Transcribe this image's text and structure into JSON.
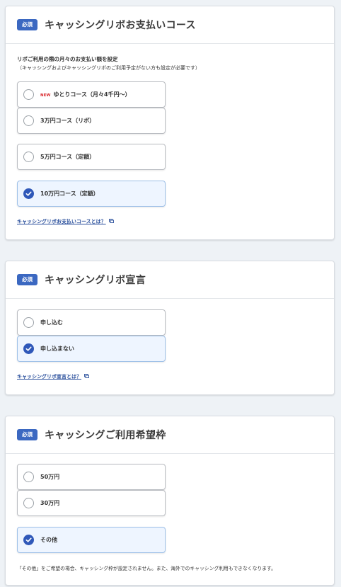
{
  "sections": [
    {
      "badge": "必須",
      "title": "キャッシングリボお支払いコース",
      "description": "リボご利用の際の月々のお支払い額を設定",
      "description_sub": "（キャッシングおよびキャッシングリボのご利用予定がない方も設定が必要です）",
      "options": [
        {
          "new_badge": "NEW",
          "label": "ゆとりコース（月々4千円〜）",
          "selected": false
        },
        {
          "label": "3万円コース（リボ）",
          "selected": false
        },
        {
          "label": "5万円コース（定額）",
          "selected": false
        },
        {
          "label": "10万円コース（定額）",
          "selected": true
        }
      ],
      "link": "キャッシングリボお支払いコースとは？"
    },
    {
      "badge": "必須",
      "title": "キャッシングリボ宣言",
      "options": [
        {
          "label": "申し込む",
          "selected": false
        },
        {
          "label": "申し込まない",
          "selected": true
        }
      ],
      "link": "キャッシングリボ宣言とは？"
    },
    {
      "badge": "必須",
      "title": "キャッシングご利用希望枠",
      "options": [
        {
          "label": "50万円",
          "selected": false
        },
        {
          "label": "30万円",
          "selected": false
        },
        {
          "label": "その他",
          "selected": true
        }
      ],
      "note": "「その他」をご希望の場合、キャッシング枠が設定されません。また、海外でのキャッシング利用もできなくなります。"
    }
  ],
  "colors": {
    "accent": "#2f58b9",
    "badge": "#3b68c1",
    "selected_bg": "#eef5ff",
    "new_badge": "#d9262b",
    "link": "#2a4f9c"
  },
  "icons": {
    "checked": "check-circle-icon",
    "unchecked": "radio-empty-icon",
    "external": "external-link-icon"
  }
}
